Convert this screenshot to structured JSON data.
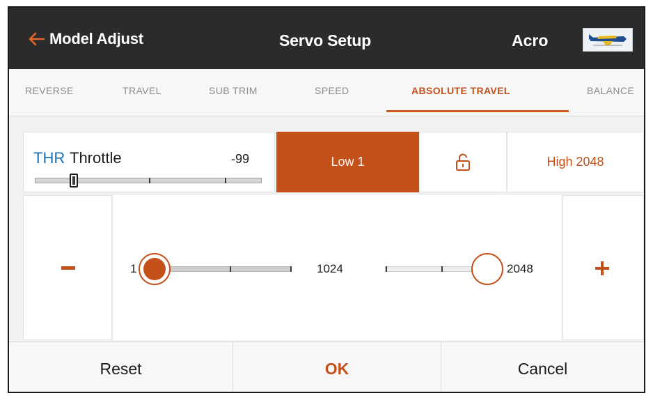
{
  "header": {
    "back_label": "Model Adjust",
    "title": "Servo Setup",
    "model_name": "Acro",
    "back_icon": "back-arrow-icon",
    "model_icon": "airplane-thumbnail-icon"
  },
  "tabs": [
    {
      "label": "REVERSE",
      "active": false
    },
    {
      "label": "TRAVEL",
      "active": false
    },
    {
      "label": "SUB TRIM",
      "active": false
    },
    {
      "label": "SPEED",
      "active": false
    },
    {
      "label": "ABSOLUTE TRAVEL",
      "active": true
    },
    {
      "label": "BALANCE",
      "active": false
    }
  ],
  "channel": {
    "code": "THR",
    "name": "Throttle",
    "value": "-99"
  },
  "low_button": "Low 1",
  "lock_icon": "unlock-icon",
  "high_button": "High 2048",
  "slider": {
    "min_label": "1",
    "mid_label": "1024",
    "max_label": "2048",
    "low_value": 1,
    "high_value": 2048
  },
  "footer": {
    "reset": "Reset",
    "ok": "OK",
    "cancel": "Cancel"
  },
  "colors": {
    "accent": "#c4501a",
    "header_bg": "#2b2b2b",
    "channel_code": "#1d6fb5"
  }
}
